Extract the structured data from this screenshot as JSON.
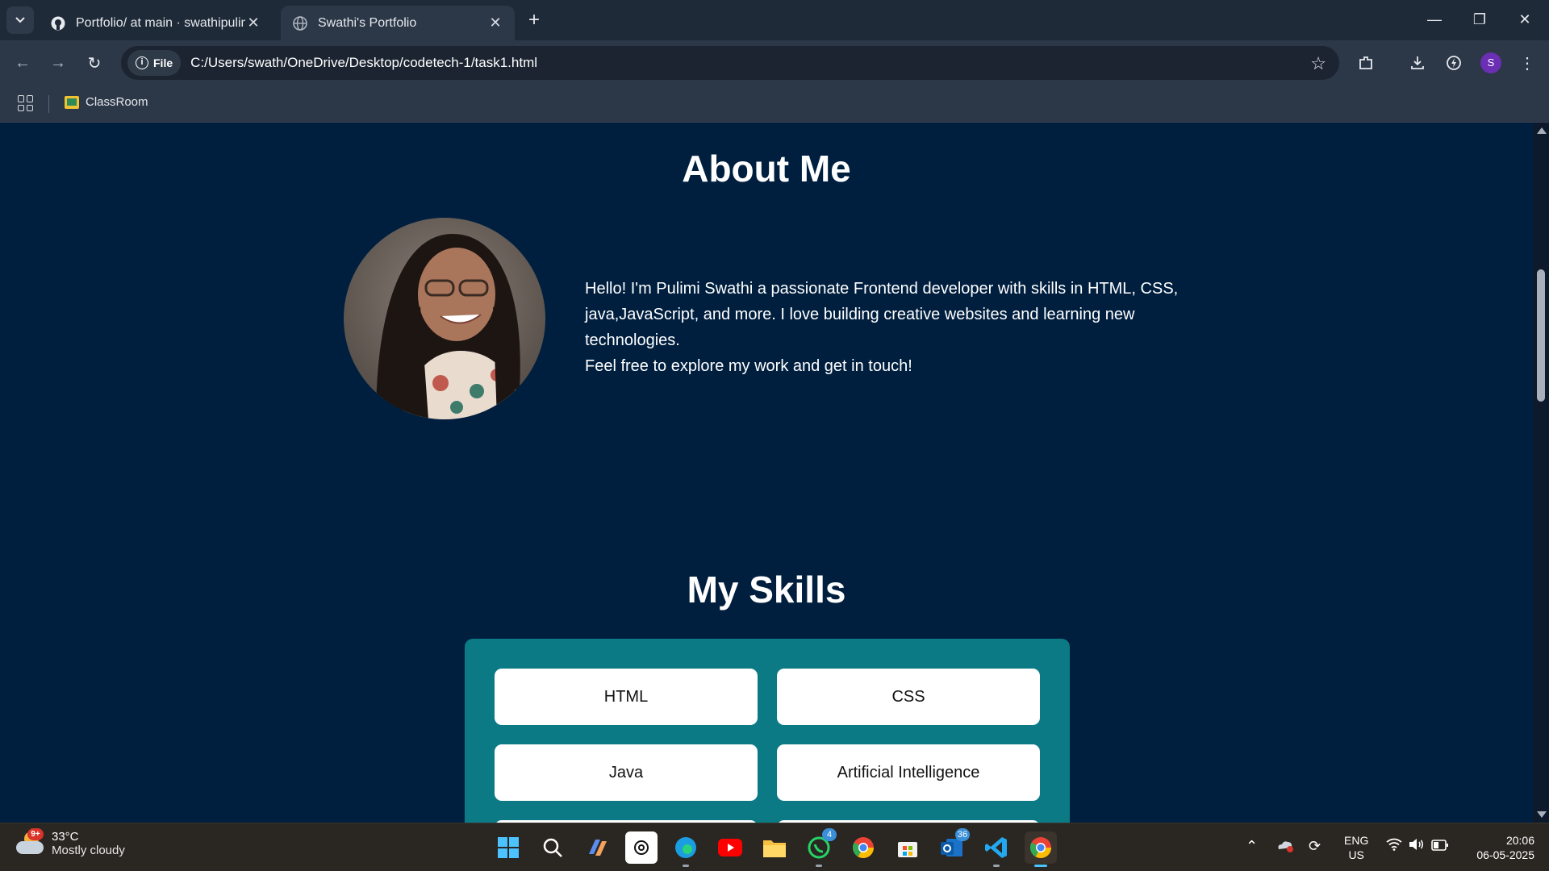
{
  "browser": {
    "tabs": [
      {
        "title": "Portfolio/ at main · swathipulimi",
        "active": false
      },
      {
        "title": "Swathi's Portfolio",
        "active": true
      }
    ],
    "new_tab_label": "+",
    "address": {
      "chip_label": "File",
      "url": "C:/Users/swath/OneDrive/Desktop/codetech-1/task1.html"
    },
    "profile_initial": "S",
    "bookmarks": [
      {
        "label": "ClassRoom"
      }
    ]
  },
  "page": {
    "about": {
      "heading": "About Me",
      "bio_line1": "Hello! I'm Pulimi Swathi a passionate Frontend developer with skills in HTML, CSS, java,JavaScript, and more. I love building creative websites and learning new technologies.",
      "bio_line2": "Feel free to explore my work and get in touch!"
    },
    "skills": {
      "heading": "My Skills",
      "items": [
        "HTML",
        "CSS",
        "Java",
        "Artificial Intelligence"
      ]
    },
    "colors": {
      "background": "#001f3f",
      "panel": "#0b7a85",
      "card": "#ffffff"
    }
  },
  "taskbar": {
    "weather": {
      "temp": "33°C",
      "condition": "Mostly cloudy",
      "badge": "9+"
    },
    "apps": [
      {
        "name": "start-icon"
      },
      {
        "name": "search-icon"
      },
      {
        "name": "copilot-icon"
      },
      {
        "name": "chatgpt-icon"
      },
      {
        "name": "edge-icon"
      },
      {
        "name": "youtube-icon"
      },
      {
        "name": "file-explorer-icon"
      },
      {
        "name": "whatsapp-icon",
        "badge": "4"
      },
      {
        "name": "chrome-icon"
      },
      {
        "name": "store-icon"
      },
      {
        "name": "outlook-icon",
        "badge": "36"
      },
      {
        "name": "vscode-icon"
      },
      {
        "name": "chrome-active-icon"
      }
    ],
    "language": {
      "line1": "ENG",
      "line2": "US"
    },
    "clock": {
      "time": "20:06",
      "date": "06-05-2025"
    }
  }
}
